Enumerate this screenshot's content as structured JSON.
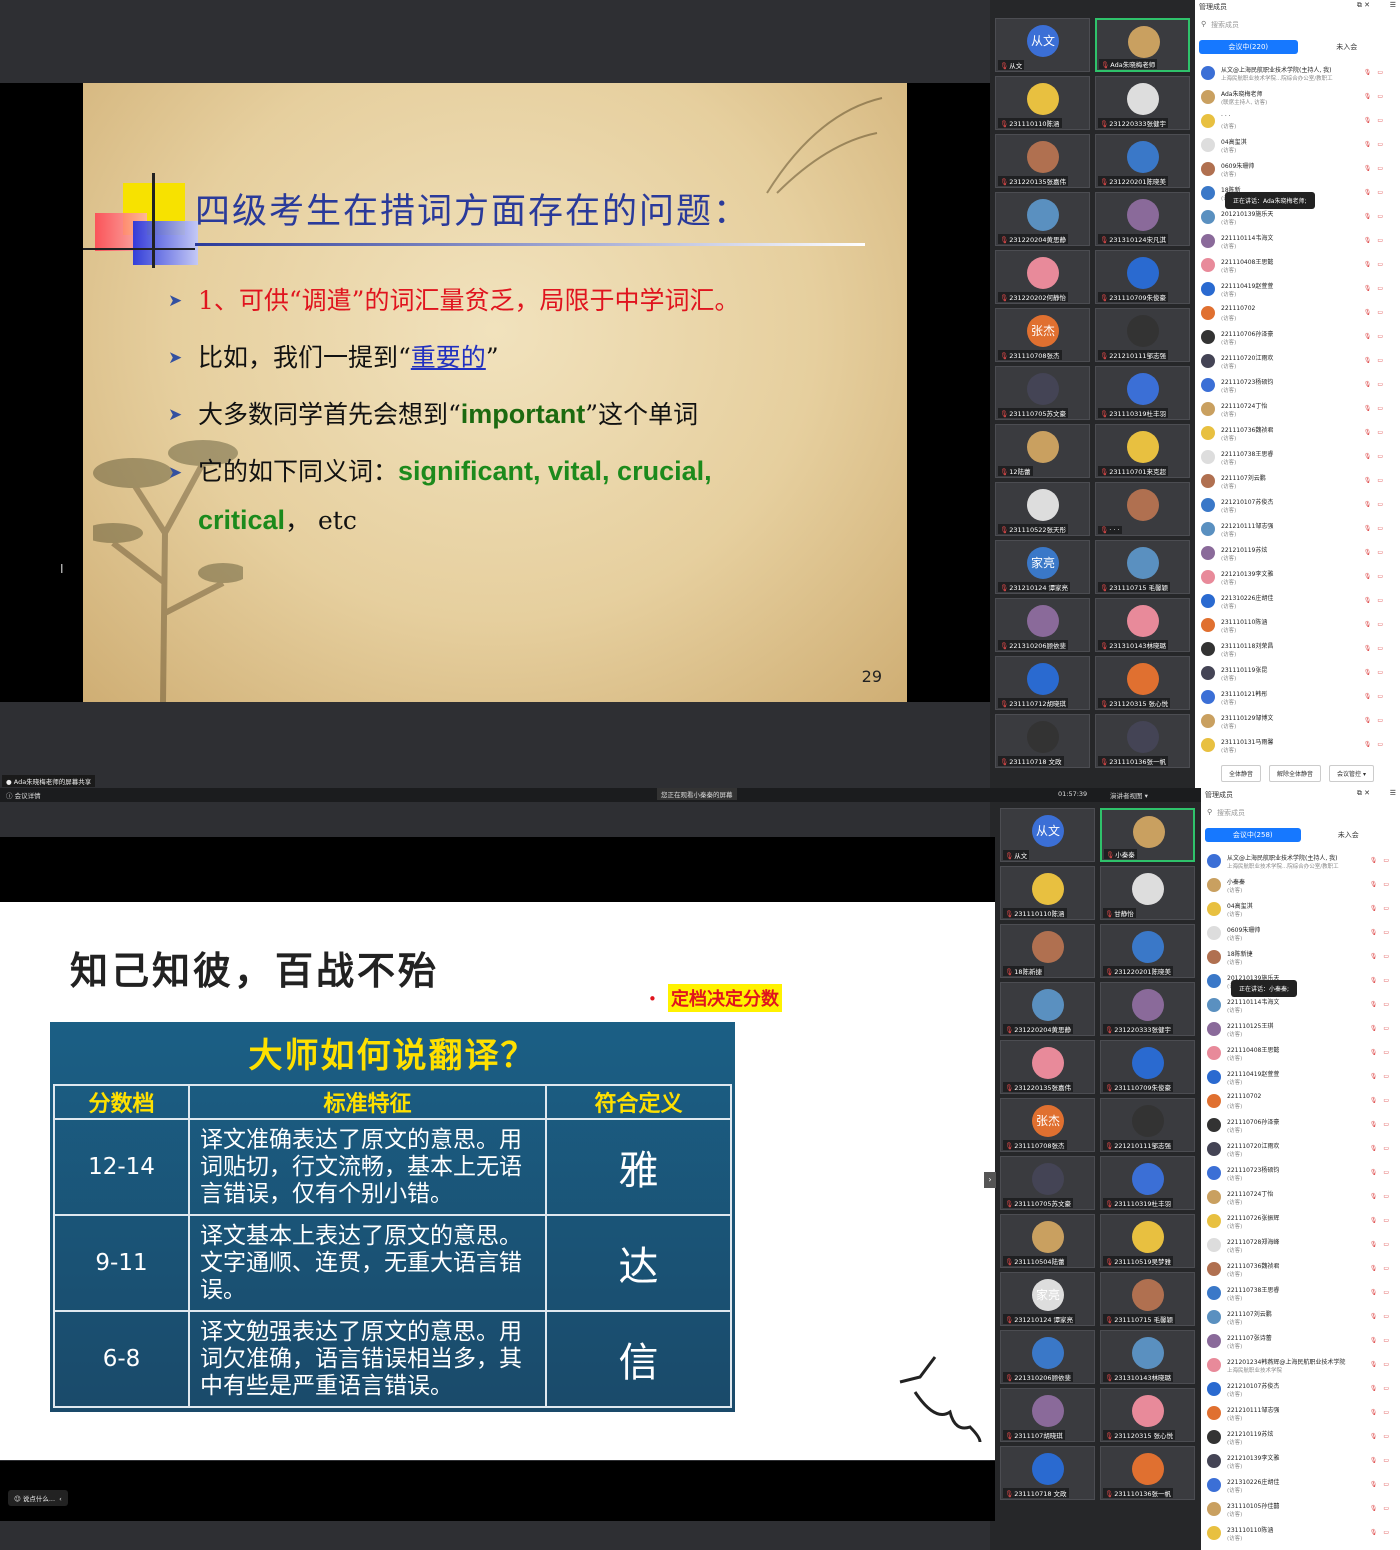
{
  "p1": {
    "slide": {
      "title": "四级考生在措词方面存在的问题：",
      "line1": "1、可供“调遣”的词汇量贫乏，局限于中学词汇。",
      "line2_pre": "比如，我们一提到“",
      "line2_link": "重要的",
      "line2_post": "”",
      "line3_pre": "大多数同学首先会想到“",
      "line3_word": "important",
      "line3_post": "”这个单词",
      "line4_pre": "它的如下同义词：",
      "line4_words": "significant, vital, crucial,",
      "line5_word": "critical",
      "line5_post": "，  etc",
      "page": "29",
      "bullet": "➤"
    },
    "share_label": "Ada朱晓梅老师的屏幕共享",
    "tiles_left": [
      "从文",
      "231110110陈涵",
      "231220135张嘉伟",
      "231220204黄思静",
      "231220202何静怡",
      "231110708张杰",
      "231110705苏文豪",
      "12陆蕾",
      "231110522张天彤",
      "231210124 谭家亮",
      "221310206顾依斐",
      "231110712胡晓琪",
      "231110718 文政"
    ],
    "tiles_right": [
      "Ada朱晓梅老师",
      "231220333张健宇",
      "231220201陈晓美",
      "231310124宋凡淇",
      "231110709朱俊豪",
      "221210111邹志强",
      "231110319杜丰羽",
      "231110701来克超",
      "· · ·",
      "231110715 毛馨颖",
      "231310143林晓璐",
      "231120315 张心悦",
      "231110136张一帆"
    ],
    "tiles_left_avtext": [
      "从文",
      "",
      "",
      "",
      "",
      "张杰",
      "",
      "",
      "",
      "家亮",
      "",
      "",
      ""
    ],
    "members_header": "管理成员",
    "search_placeholder": "搜索成员",
    "tab_in": "会议中(220)",
    "tab_out": "未入会",
    "members": [
      {
        "n": "从文@上海民航职业技术学院(主持人, 我)",
        "s": "上海民航职业技术学院...院综合办公室/教职工"
      },
      {
        "n": "Ada朱晓梅老师",
        "s": "(联席主持人, 访客)"
      },
      {
        "n": "· · ·",
        "s": "(访客)"
      },
      {
        "n": "04高玺淇",
        "s": "(访客)"
      },
      {
        "n": "0609朱珊帅",
        "s": "(访客)"
      },
      {
        "n": "18陈新",
        "s": "(访客)"
      },
      {
        "n": "201210139施乐天",
        "s": "(访客)"
      },
      {
        "n": "221110114韦海文",
        "s": "(访客)"
      },
      {
        "n": "221110408王思懿",
        "s": "(访客)"
      },
      {
        "n": "221110419赵萱萱",
        "s": "(访客)"
      },
      {
        "n": "221110702",
        "s": "(访客)"
      },
      {
        "n": "221110706孙泽豪",
        "s": "(访客)"
      },
      {
        "n": "221110720江雨欢",
        "s": "(访客)"
      },
      {
        "n": "221110723杨硕钧",
        "s": "(访客)"
      },
      {
        "n": "221110724丁怡",
        "s": "(访客)"
      },
      {
        "n": "221110736魏祯君",
        "s": "(访客)"
      },
      {
        "n": "221110738王思睿",
        "s": "(访客)"
      },
      {
        "n": "2211107刘云鹏",
        "s": "(访客)"
      },
      {
        "n": "221210107苏俊杰",
        "s": "(访客)"
      },
      {
        "n": "221210111邹志强",
        "s": "(访客)"
      },
      {
        "n": "221210119苏炫",
        "s": "(访客)"
      },
      {
        "n": "221210139李文雅",
        "s": "(访客)"
      },
      {
        "n": "221310226庄胡佳",
        "s": "(访客)"
      },
      {
        "n": "231110110陈涵",
        "s": "(访客)"
      },
      {
        "n": "231110118刘荣昌",
        "s": "(访客)"
      },
      {
        "n": "231110119张昆",
        "s": "(访客)"
      },
      {
        "n": "231110121韩彤",
        "s": "(访客)"
      },
      {
        "n": "231110129邹博文",
        "s": "(访客)"
      },
      {
        "n": "231110131马雨馨",
        "s": "(访客)"
      }
    ],
    "speaking": "正在讲话：Ada朱晓梅老师;",
    "foot": [
      "全体静音",
      "解除全体静音",
      "会议管控 ▾"
    ]
  },
  "p2": {
    "topbar": {
      "info": "会议详情",
      "watching": "您正在观看小秦秦的屏幕",
      "time": "01:57:39",
      "view": "演讲者视图 ▾"
    },
    "slide": {
      "title": "知己知彼，百战不殆",
      "note": "定档决定分数",
      "note_dot": "•",
      "board_title": "大师如何说翻译？",
      "headers": [
        "分数档",
        "标准特征",
        "符合定义"
      ],
      "rows": [
        {
          "score": "12-14",
          "desc": "译文准确表达了原文的意思。用词贴切，行文流畅，基本上无语言错误，仅有个别小错。",
          "def": "雅"
        },
        {
          "score": "9-11",
          "desc": "译文基本上表达了原文的意思。文字通顺、连贯，无重大语言错误。",
          "def": "达"
        },
        {
          "score": "6-8",
          "desc": "译文勉强表达了原文的意思。用词欠准确，语言错误相当多，其中有些是严重语言错误。",
          "def": "信"
        }
      ]
    },
    "chat_placeholder": "说点什么...",
    "tiles_left": [
      "从文",
      "231110110陈涵",
      "18陈新捷",
      "231220204黄思静",
      "231220135张嘉伟",
      "231110708张杰",
      "231110705苏文豪",
      "231110504陆蕾",
      "231210124 谭家亮",
      "221310206顾依斐",
      "2311107胡晓琪",
      "231110718 文政"
    ],
    "tiles_right": [
      "小秦秦",
      "甘静怡",
      "231220201陈晓美",
      "231220333张健宇",
      "231110709朱俊豪",
      "221210111邹志强",
      "231110319杜丰羽",
      "231110519吴梦雅",
      "231110715 毛馨颖",
      "231310143林晓璐",
      "231120315 张心悦",
      "231110136张一帆"
    ],
    "tiles_left_avtext": [
      "从文",
      "",
      "",
      "",
      "",
      "张杰",
      "",
      "",
      "家亮",
      "",
      "",
      ""
    ],
    "members_header": "管理成员",
    "search_placeholder": "搜索成员",
    "tab_in": "会议中(258)",
    "tab_out": "未入会",
    "members": [
      {
        "n": "从文@上海民航职业技术学院(主持人, 我)",
        "s": "上海民航职业技术学院...院综合办公室/教职工"
      },
      {
        "n": "小秦秦",
        "s": "(访客)"
      },
      {
        "n": "04高玺淇",
        "s": "(访客)"
      },
      {
        "n": "0609朱珊帅",
        "s": "(访客)"
      },
      {
        "n": "18陈新捷",
        "s": "(访客)"
      },
      {
        "n": "201210139施乐天",
        "s": "(访客)"
      },
      {
        "n": "221110114韦海文",
        "s": "(访客)"
      },
      {
        "n": "221110125王琪",
        "s": "(访客)"
      },
      {
        "n": "221110408王思懿",
        "s": "(访客)"
      },
      {
        "n": "221110419赵萱萱",
        "s": "(访客)"
      },
      {
        "n": "221110702",
        "s": "(访客)"
      },
      {
        "n": "221110706孙泽豪",
        "s": "(访客)"
      },
      {
        "n": "221110720江雨欢",
        "s": "(访客)"
      },
      {
        "n": "221110723杨硕钧",
        "s": "(访客)"
      },
      {
        "n": "221110724丁怡",
        "s": "(访客)"
      },
      {
        "n": "221110726张振辉",
        "s": "(访客)"
      },
      {
        "n": "221110728郑海峰",
        "s": "(访客)"
      },
      {
        "n": "221110736魏祯君",
        "s": "(访客)"
      },
      {
        "n": "221110738王思睿",
        "s": "(访客)"
      },
      {
        "n": "2211107刘云鹏",
        "s": "(访客)"
      },
      {
        "n": "2211107张诗蕾",
        "s": "(访客)"
      },
      {
        "n": "221201234韩燕辉@上海民航职业技术学院",
        "s": "上海民航职业技术学院"
      },
      {
        "n": "221210107苏俊杰",
        "s": "(访客)"
      },
      {
        "n": "221210111邹志强",
        "s": "(访客)"
      },
      {
        "n": "221210119苏炫",
        "s": "(访客)"
      },
      {
        "n": "221210139李文雅",
        "s": "(访客)"
      },
      {
        "n": "221310226庄胡佳",
        "s": "(访客)"
      },
      {
        "n": "231110105孙佳囍",
        "s": "(访客)"
      },
      {
        "n": "231110110陈涵",
        "s": "(访客)"
      }
    ],
    "speaking": "正在讲话：小秦秦;"
  },
  "colors": {
    "accent": "#1678ff",
    "green_border": "#2fc26b",
    "mic_red": "#e84b4b"
  }
}
